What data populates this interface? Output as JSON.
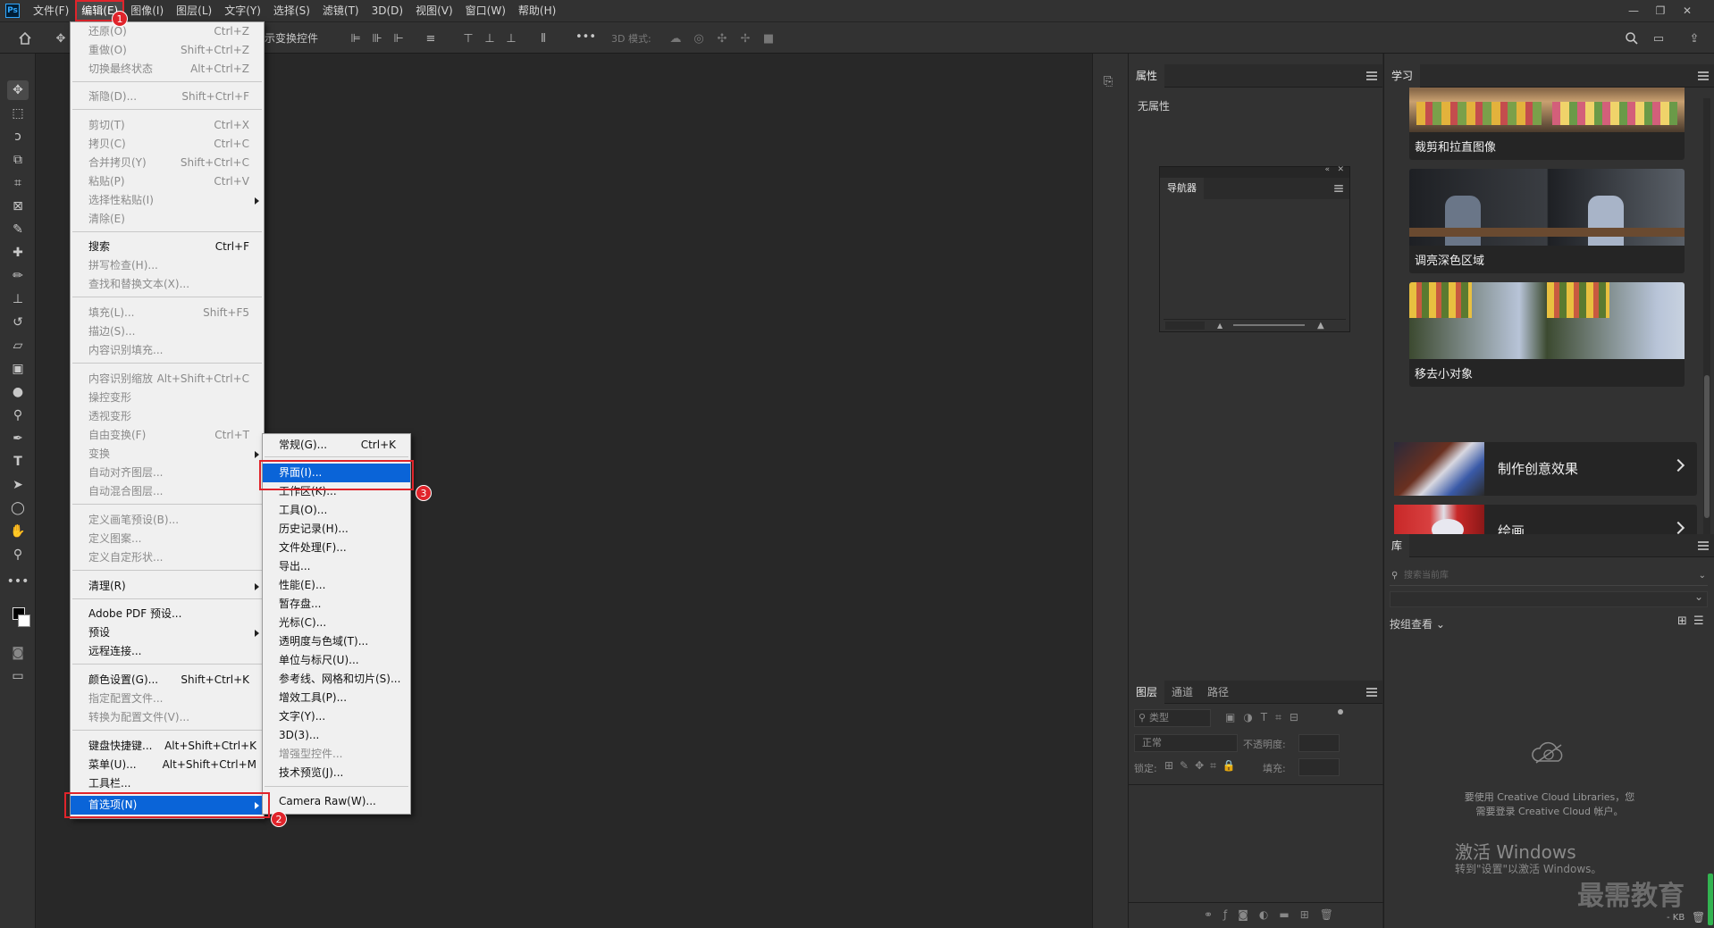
{
  "menubar": {
    "logo": "Ps",
    "items": [
      "文件(F)",
      "编辑(E)",
      "图像(I)",
      "图层(L)",
      "文字(Y)",
      "选择(S)",
      "滤镜(T)",
      "3D(D)",
      "视图(V)",
      "窗口(W)",
      "帮助(H)"
    ]
  },
  "optbar": {
    "show_transform": "示变换控件",
    "mode_3d": "3D 模式:",
    "more": "•••"
  },
  "edit_menu": {
    "items": [
      {
        "label": "还原(O)",
        "shortcut": "Ctrl+Z",
        "state": "dis"
      },
      {
        "label": "重做(O)",
        "shortcut": "Shift+Ctrl+Z",
        "state": "dis"
      },
      {
        "label": "切换最终状态",
        "shortcut": "Alt+Ctrl+Z",
        "state": "dis"
      },
      {
        "label": "渐隐(D)...",
        "shortcut": "Shift+Ctrl+F",
        "state": "dis"
      },
      {
        "label": "剪切(T)",
        "shortcut": "Ctrl+X",
        "state": "dis"
      },
      {
        "label": "拷贝(C)",
        "shortcut": "Ctrl+C",
        "state": "dis"
      },
      {
        "label": "合并拷贝(Y)",
        "shortcut": "Shift+Ctrl+C",
        "state": "dis"
      },
      {
        "label": "粘贴(P)",
        "shortcut": "Ctrl+V",
        "state": "dis"
      },
      {
        "label": "选择性粘贴(I)",
        "shortcut": "",
        "state": "dis"
      },
      {
        "label": "清除(E)",
        "shortcut": "",
        "state": "dis"
      },
      {
        "label": "搜索",
        "shortcut": "Ctrl+F",
        "state": "en"
      },
      {
        "label": "拼写检查(H)...",
        "shortcut": "",
        "state": "dis"
      },
      {
        "label": "查找和替换文本(X)...",
        "shortcut": "",
        "state": "dis"
      },
      {
        "label": "填充(L)...",
        "shortcut": "Shift+F5",
        "state": "dis"
      },
      {
        "label": "描边(S)...",
        "shortcut": "",
        "state": "dis"
      },
      {
        "label": "内容识别填充...",
        "shortcut": "",
        "state": "dis"
      },
      {
        "label": "内容识别缩放",
        "shortcut": "Alt+Shift+Ctrl+C",
        "state": "dis"
      },
      {
        "label": "操控变形",
        "shortcut": "",
        "state": "dis"
      },
      {
        "label": "透视变形",
        "shortcut": "",
        "state": "dis"
      },
      {
        "label": "自由变换(F)",
        "shortcut": "Ctrl+T",
        "state": "dis"
      },
      {
        "label": "变换",
        "shortcut": "",
        "state": "dis"
      },
      {
        "label": "自动对齐图层...",
        "shortcut": "",
        "state": "dis"
      },
      {
        "label": "自动混合图层...",
        "shortcut": "",
        "state": "dis"
      },
      {
        "label": "定义画笔预设(B)...",
        "shortcut": "",
        "state": "dis"
      },
      {
        "label": "定义图案...",
        "shortcut": "",
        "state": "dis"
      },
      {
        "label": "定义自定形状...",
        "shortcut": "",
        "state": "dis"
      },
      {
        "label": "清理(R)",
        "shortcut": "",
        "state": "en"
      },
      {
        "label": "Adobe PDF 预设...",
        "shortcut": "",
        "state": "en"
      },
      {
        "label": "预设",
        "shortcut": "",
        "state": "en"
      },
      {
        "label": "远程连接...",
        "shortcut": "",
        "state": "en"
      },
      {
        "label": "颜色设置(G)...",
        "shortcut": "Shift+Ctrl+K",
        "state": "en"
      },
      {
        "label": "指定配置文件...",
        "shortcut": "",
        "state": "dis"
      },
      {
        "label": "转换为配置文件(V)...",
        "shortcut": "",
        "state": "dis"
      },
      {
        "label": "键盘快捷键...",
        "shortcut": "Alt+Shift+Ctrl+K",
        "state": "en"
      },
      {
        "label": "菜单(U)...",
        "shortcut": "Alt+Shift+Ctrl+M",
        "state": "en"
      },
      {
        "label": "工具栏...",
        "shortcut": "",
        "state": "en"
      },
      {
        "label": "首选项(N)",
        "shortcut": "",
        "state": "hl"
      }
    ]
  },
  "prefs_submenu": {
    "items": [
      {
        "label": "常规(G)...",
        "shortcut": "Ctrl+K",
        "state": "en"
      },
      {
        "label": "界面(I)...",
        "shortcut": "",
        "state": "hl"
      },
      {
        "label": "工作区(K)...",
        "shortcut": "",
        "state": "en"
      },
      {
        "label": "工具(O)...",
        "shortcut": "",
        "state": "en"
      },
      {
        "label": "历史记录(H)...",
        "shortcut": "",
        "state": "en"
      },
      {
        "label": "文件处理(F)...",
        "shortcut": "",
        "state": "en"
      },
      {
        "label": "导出...",
        "shortcut": "",
        "state": "en"
      },
      {
        "label": "性能(E)...",
        "shortcut": "",
        "state": "en"
      },
      {
        "label": "暂存盘...",
        "shortcut": "",
        "state": "en"
      },
      {
        "label": "光标(C)...",
        "shortcut": "",
        "state": "en"
      },
      {
        "label": "透明度与色域(T)...",
        "shortcut": "",
        "state": "en"
      },
      {
        "label": "单位与标尺(U)...",
        "shortcut": "",
        "state": "en"
      },
      {
        "label": "参考线、网格和切片(S)...",
        "shortcut": "",
        "state": "en"
      },
      {
        "label": "增效工具(P)...",
        "shortcut": "",
        "state": "en"
      },
      {
        "label": "文字(Y)...",
        "shortcut": "",
        "state": "en"
      },
      {
        "label": "3D(3)...",
        "shortcut": "",
        "state": "en"
      },
      {
        "label": "增强型控件...",
        "shortcut": "",
        "state": "dis"
      },
      {
        "label": "技术预览(J)...",
        "shortcut": "",
        "state": "en"
      },
      {
        "label": "Camera Raw(W)...",
        "shortcut": "",
        "state": "en"
      }
    ]
  },
  "badges": [
    "1",
    "2",
    "3"
  ],
  "properties": {
    "tab": "属性",
    "empty": "无属性"
  },
  "navigator": {
    "tab": "导航器"
  },
  "layers": {
    "tabs": [
      "图层",
      "通道",
      "路径"
    ],
    "kind_placeholder": "类型",
    "blend": "正常",
    "opacity_label": "不透明度:",
    "lock_label": "锁定:",
    "fill_label": "填充:"
  },
  "learn": {
    "tab": "学习",
    "thumbs": [
      "裁剪和拉直图像",
      "调亮深色区域",
      "移去小对象"
    ],
    "cards": [
      "制作创意效果",
      "绘画"
    ]
  },
  "library": {
    "tab": "库",
    "search_placeholder": "搜索当前库",
    "group_view": "按组查看",
    "cc_msg1": "要使用 Creative Cloud Libraries，您",
    "cc_msg2": "需要登录 Creative Cloud 帐户。",
    "kb": "- KB"
  },
  "watermark": {
    "activate": "激活 Windows",
    "activate_sub": "转到\"设置\"以激活 Windows。",
    "brand": "最需教育"
  },
  "colors": {
    "highlight": "#0a64d8",
    "annotation": "#e0242b",
    "menu_bg": "#f0f0f0",
    "app_bg": "#323232"
  }
}
